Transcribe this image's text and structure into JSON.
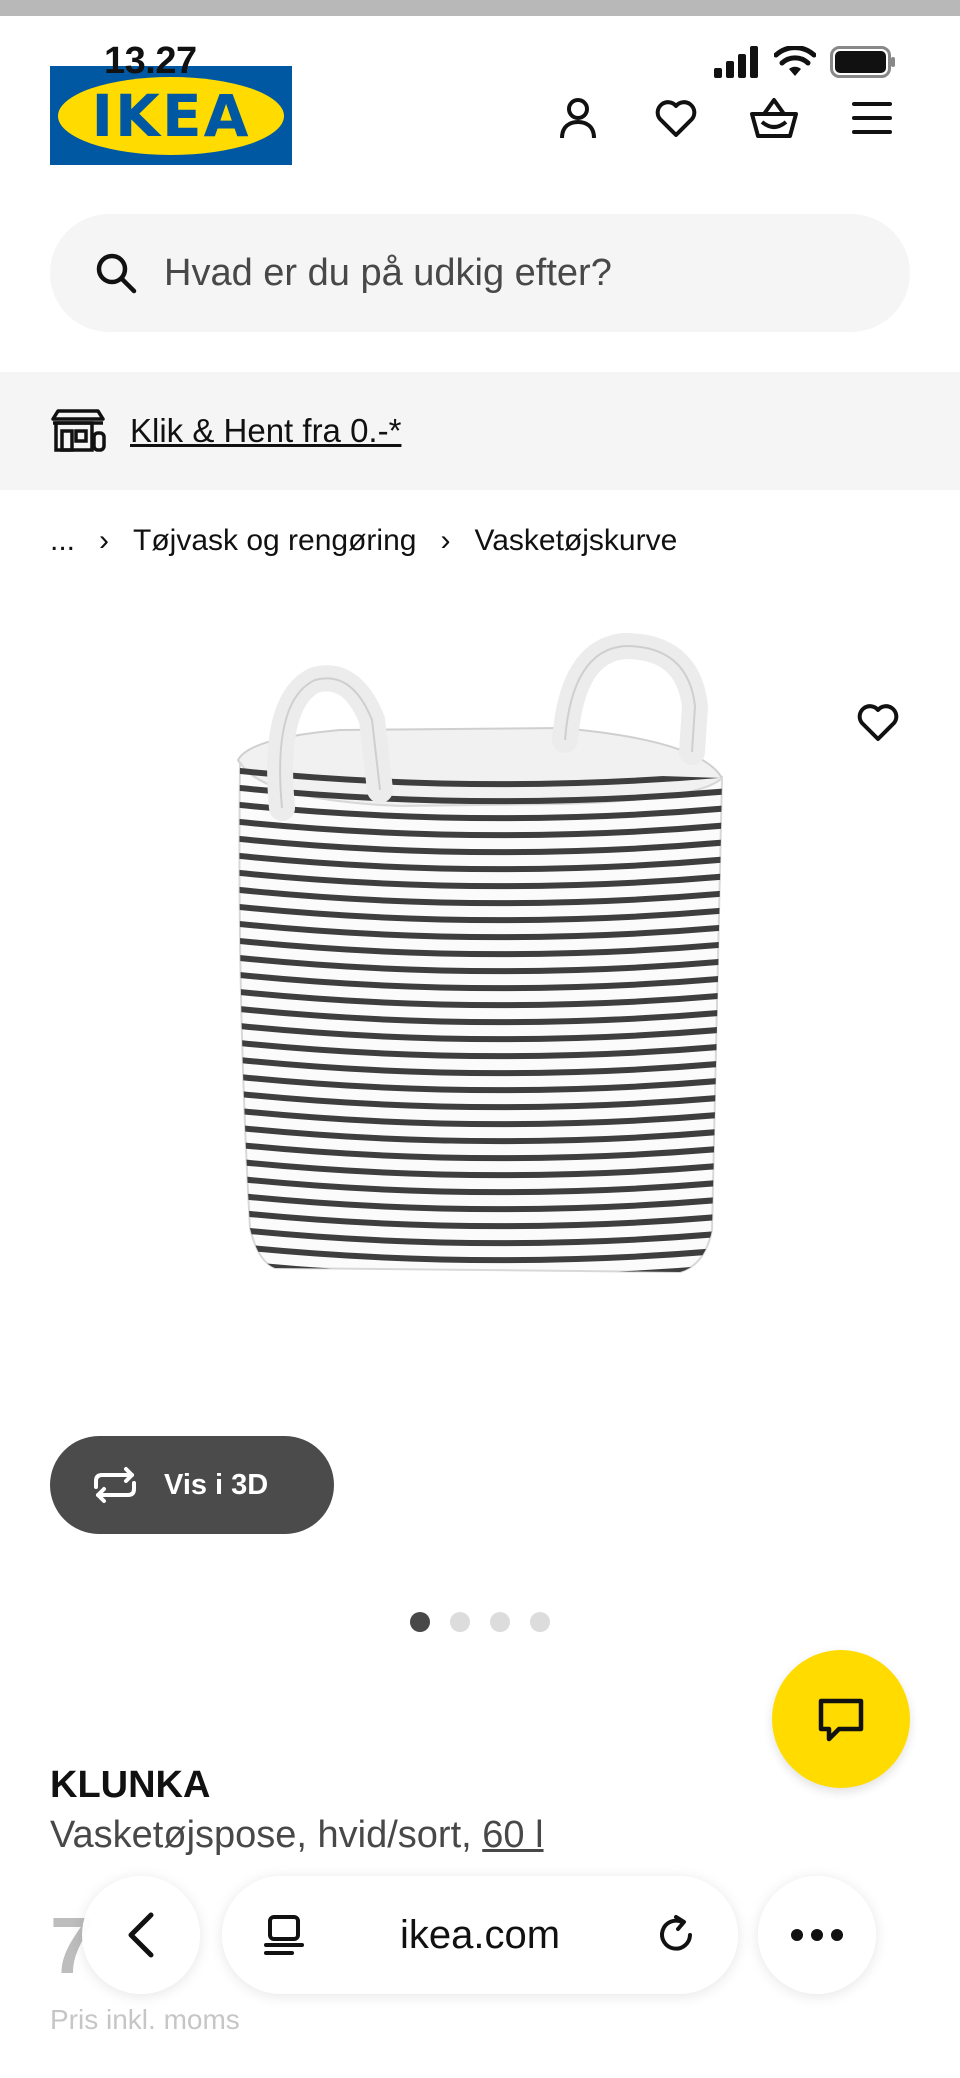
{
  "status_bar": {
    "time": "13.27",
    "icons": [
      "signal-icon",
      "wifi-icon",
      "battery-icon"
    ]
  },
  "header": {
    "logo_text": "IKEA",
    "icons": [
      "account-icon",
      "heart-icon",
      "basket-icon",
      "menu-icon"
    ]
  },
  "search": {
    "placeholder": "Hvad er du på udkig efter?"
  },
  "promo": {
    "link_text": "Klik & Hent fra 0.-*",
    "icon": "store-icon"
  },
  "breadcrumb": {
    "items": [
      "...",
      "Tøjvask og rengøring",
      "Vasketøjskurve"
    ]
  },
  "gallery": {
    "view_3d_label": "Vis i 3D",
    "dot_count": 4,
    "active_index": 0
  },
  "product": {
    "name": "KLUNKA",
    "description": "Vasketøjspose, hvid/sort,",
    "size_link": "60 l",
    "price_partial": "7",
    "price_note": "Pris inkl. moms"
  },
  "browser": {
    "url": "ikea.com"
  },
  "colors": {
    "ikea_blue": "#0058a3",
    "ikea_yellow": "#ffdb00",
    "pill_bg": "#f5f5f5"
  }
}
